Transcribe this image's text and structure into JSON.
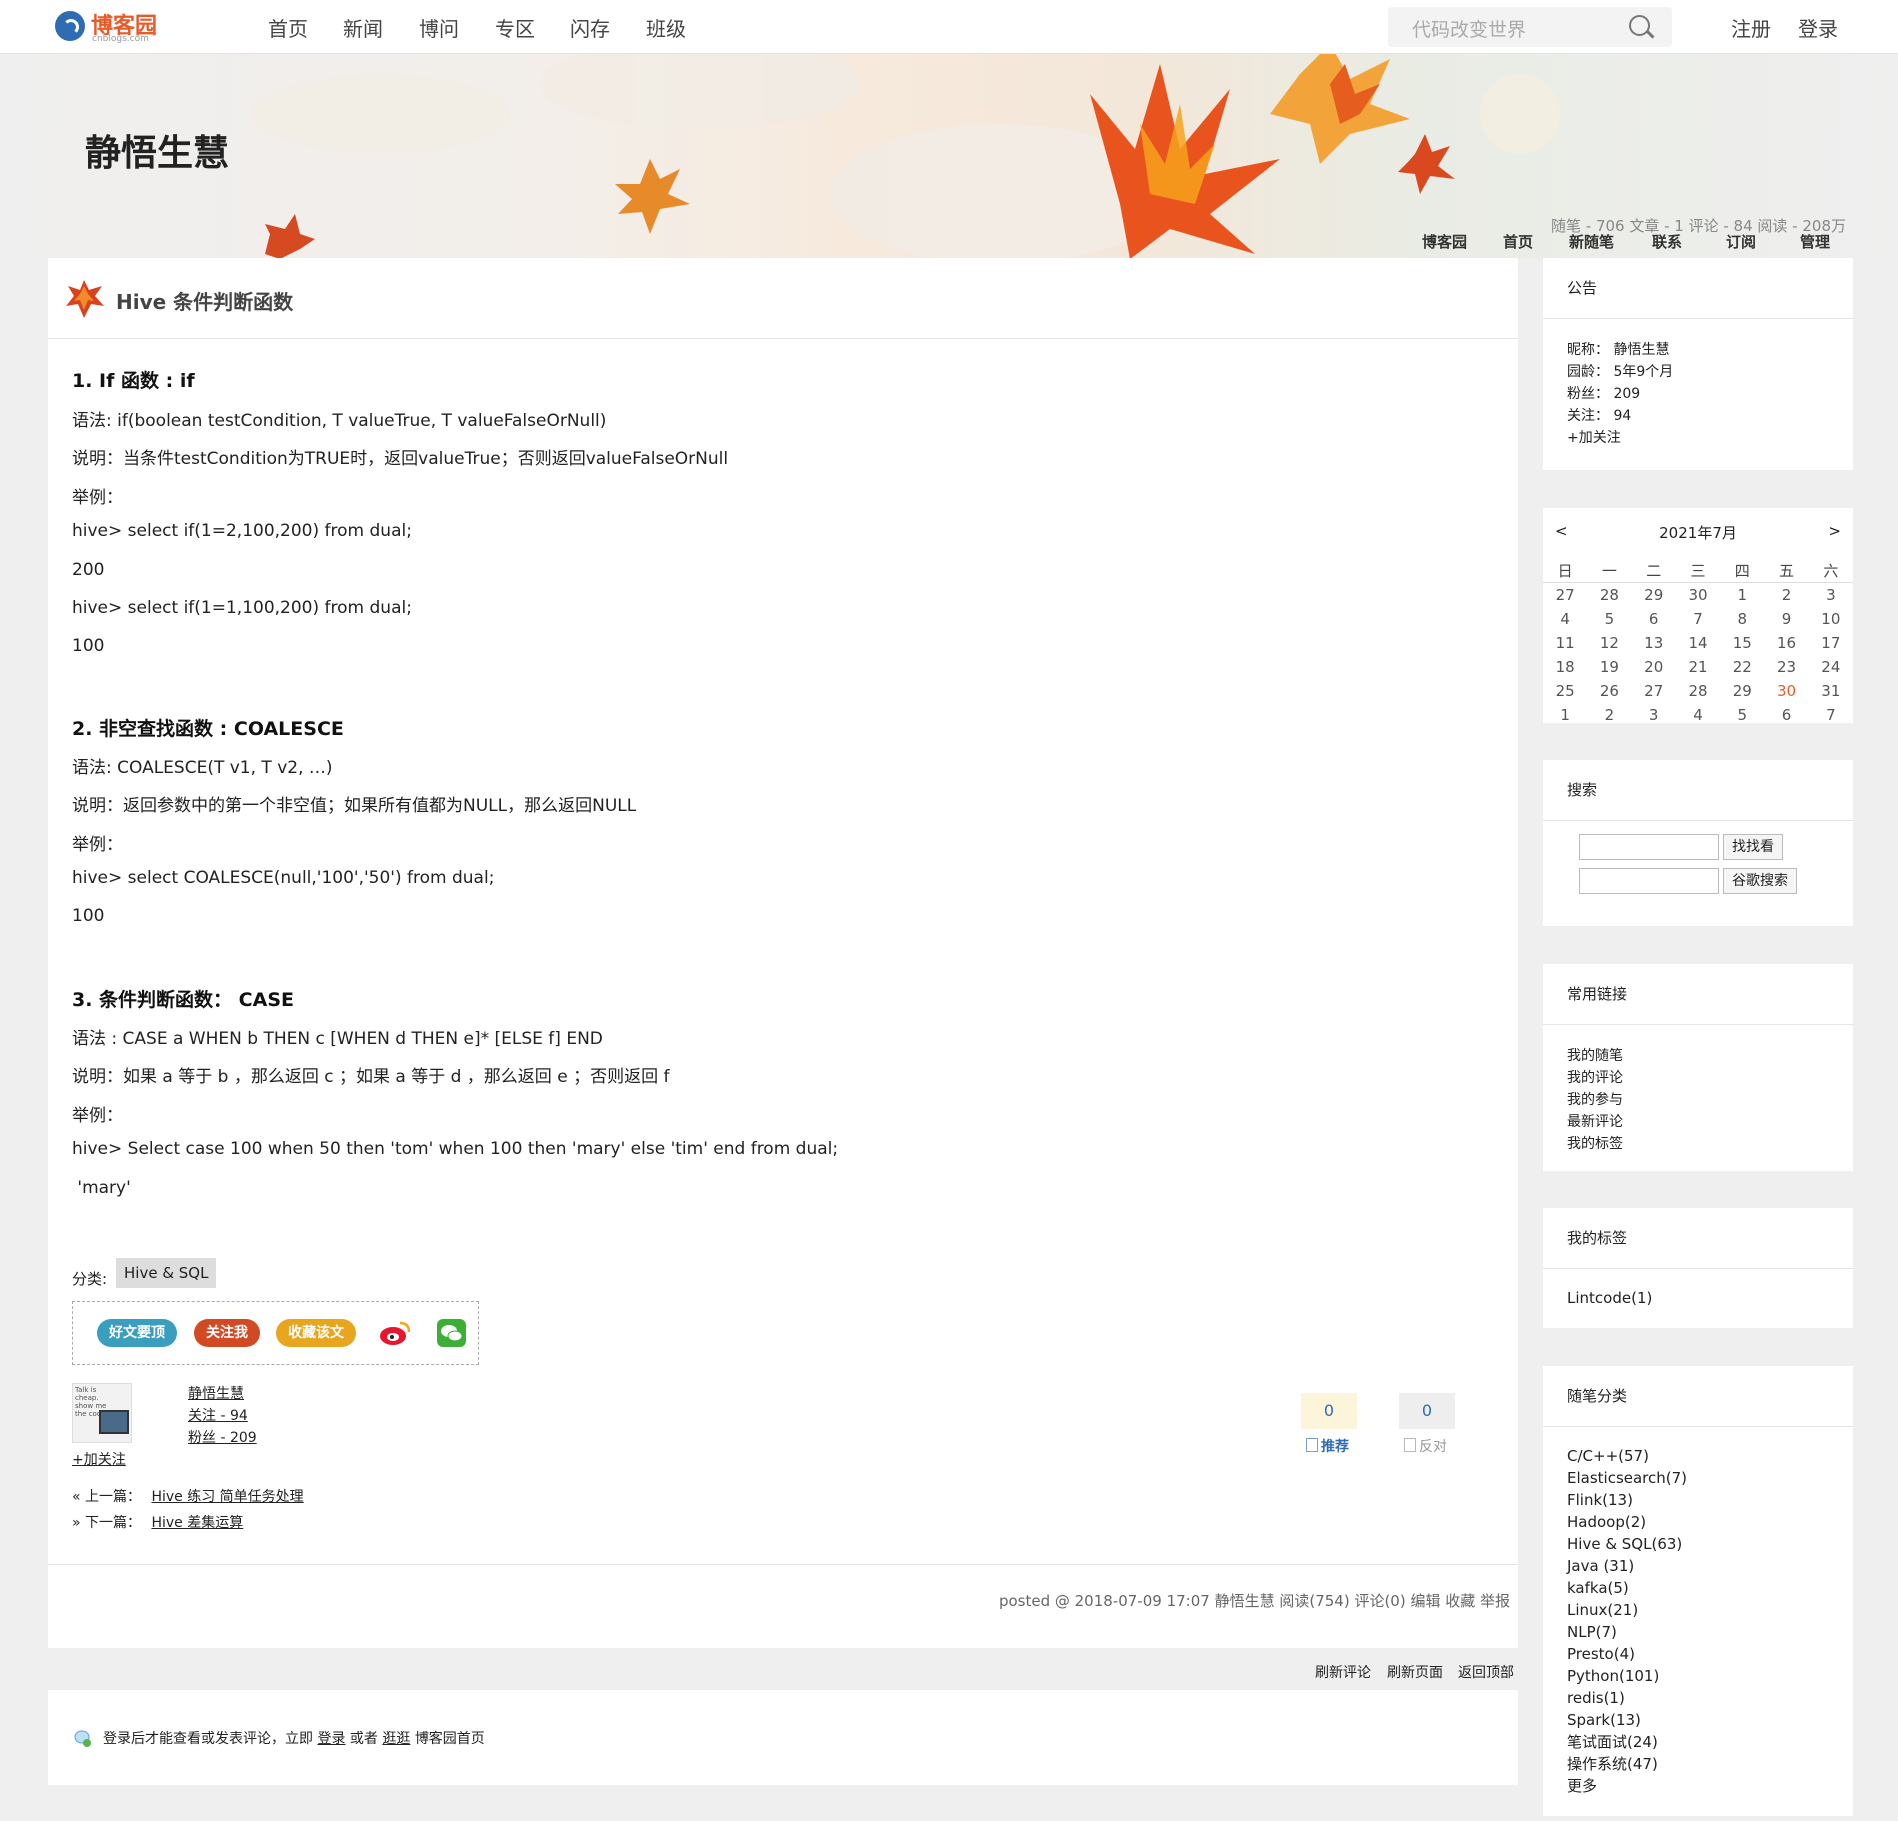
{
  "topnav": {
    "logo_text": "博客园",
    "logo_sub": "cnblogs.com",
    "links": [
      "首页",
      "新闻",
      "博问",
      "专区",
      "闪存",
      "班级"
    ],
    "search_placeholder": "代码改变世界",
    "register": "注册",
    "login": "登录"
  },
  "banner": {
    "blog_title": "静悟生慧",
    "nav": [
      "博客园",
      "首页",
      "新随笔",
      "联系",
      "订阅",
      "管理"
    ],
    "stats": "随笔 - 706  文章 - 1  评论 - 84  阅读 - 208万"
  },
  "post": {
    "title": "Hive 条件判断函数",
    "sections": [
      {
        "heading": "1.  If 函数 : if",
        "lines": [
          "语法: if(boolean testCondition, T valueTrue, T valueFalseOrNull)",
          "说明：当条件testCondition为TRUE时，返回valueTrue；否则返回valueFalseOrNull",
          "举例：",
          "hive> select if(1=2,100,200) from dual;",
          "200",
          "hive> select if(1=1,100,200) from dual;",
          "100"
        ]
      },
      {
        "heading": "2. 非空查找函数 : COALESCE",
        "lines": [
          "语法: COALESCE(T v1, T v2, …)",
          "说明：返回参数中的第一个非空值；如果所有值都为NULL，那么返回NULL",
          "举例：",
          "hive> select COALESCE(null,'100','50') from dual;",
          "100"
        ]
      },
      {
        "heading": "3. 条件判断函数：  CASE",
        "lines": [
          "语法 : CASE a WHEN b THEN c [WHEN d THEN e]* [ELSE f] END",
          "说明：如果 a 等于 b ，那么返回 c ；如果 a 等于 d ，那么返回 e ；否则返回 f",
          "举例：",
          "hive> Select case 100 when 50 then 'tom' when 100 then 'mary' else 'tim' end from dual;",
          " 'mary'"
        ]
      }
    ],
    "category_label": "分类:",
    "category": "Hive & SQL",
    "share": [
      "好文要顶",
      "关注我",
      "收藏该文"
    ],
    "author": {
      "name": "静悟生慧",
      "follow": "关注 - 94",
      "fans": "粉丝 - 209",
      "add_follow": "+加关注"
    },
    "avatar_text": "Talk is cheap. show me the code.",
    "votes": {
      "up": "0",
      "up_label": "推荐",
      "down": "0",
      "down_label": "反对"
    },
    "prev_label": "« 上一篇：",
    "prev": "Hive 练习 简单任务处理",
    "next_label": "» 下一篇：",
    "next": "Hive 差集运算",
    "desc": "posted @ 2018-07-09 17:07  静悟生慧  阅读(754)  评论(0)  编辑  收藏  举报"
  },
  "bottom": {
    "links": [
      "刷新评论",
      "刷新页面",
      "返回顶部"
    ],
    "login_prefix": "登录后才能查看或发表评论，立即",
    "login_link": "登录",
    "or": "或者",
    "browse": "逛逛",
    "home": "博客园首页"
  },
  "sidebar": {
    "notice_title": "公告",
    "notice": {
      "nick": "昵称：  静悟生慧",
      "age": "园龄：  5年9个月",
      "fans": "粉丝：  209",
      "follow": "关注：  94",
      "add_follow": "+加关注"
    },
    "calendar": {
      "title": "2021年7月",
      "prev": "<",
      "next": ">",
      "weekdays": [
        "日",
        "一",
        "二",
        "三",
        "四",
        "五",
        "六"
      ],
      "weeks": [
        [
          "27",
          "28",
          "29",
          "30",
          "1",
          "2",
          "3"
        ],
        [
          "4",
          "5",
          "6",
          "7",
          "8",
          "9",
          "10"
        ],
        [
          "11",
          "12",
          "13",
          "14",
          "15",
          "16",
          "17"
        ],
        [
          "18",
          "19",
          "20",
          "21",
          "22",
          "23",
          "24"
        ],
        [
          "25",
          "26",
          "27",
          "28",
          "29",
          "30",
          "31"
        ],
        [
          "1",
          "2",
          "3",
          "4",
          "5",
          "6",
          "7"
        ]
      ],
      "today": "30",
      "today_color": "#e85a2a"
    },
    "search_title": "搜索",
    "search_btn": "找找看",
    "google_btn": "谷歌搜索",
    "links_title": "常用链接",
    "links": [
      "我的随笔",
      "我的评论",
      "我的参与",
      "最新评论",
      "我的标签"
    ],
    "tags_title": "我的标签",
    "tags": [
      "Lintcode(1)"
    ],
    "cats_title": "随笔分类",
    "cats": [
      "C/C++(57)",
      "Elasticsearch(7)",
      "Flink(13)",
      "Hadoop(2)",
      "Hive & SQL(63)",
      "Java (31)",
      "kafka(5)",
      "Linux(21)",
      "NLP(7)",
      "Presto(4)",
      "Python(101)",
      "redis(1)",
      "Spark(13)",
      "笔试面试(24)",
      "操作系统(47)",
      "更多"
    ]
  }
}
